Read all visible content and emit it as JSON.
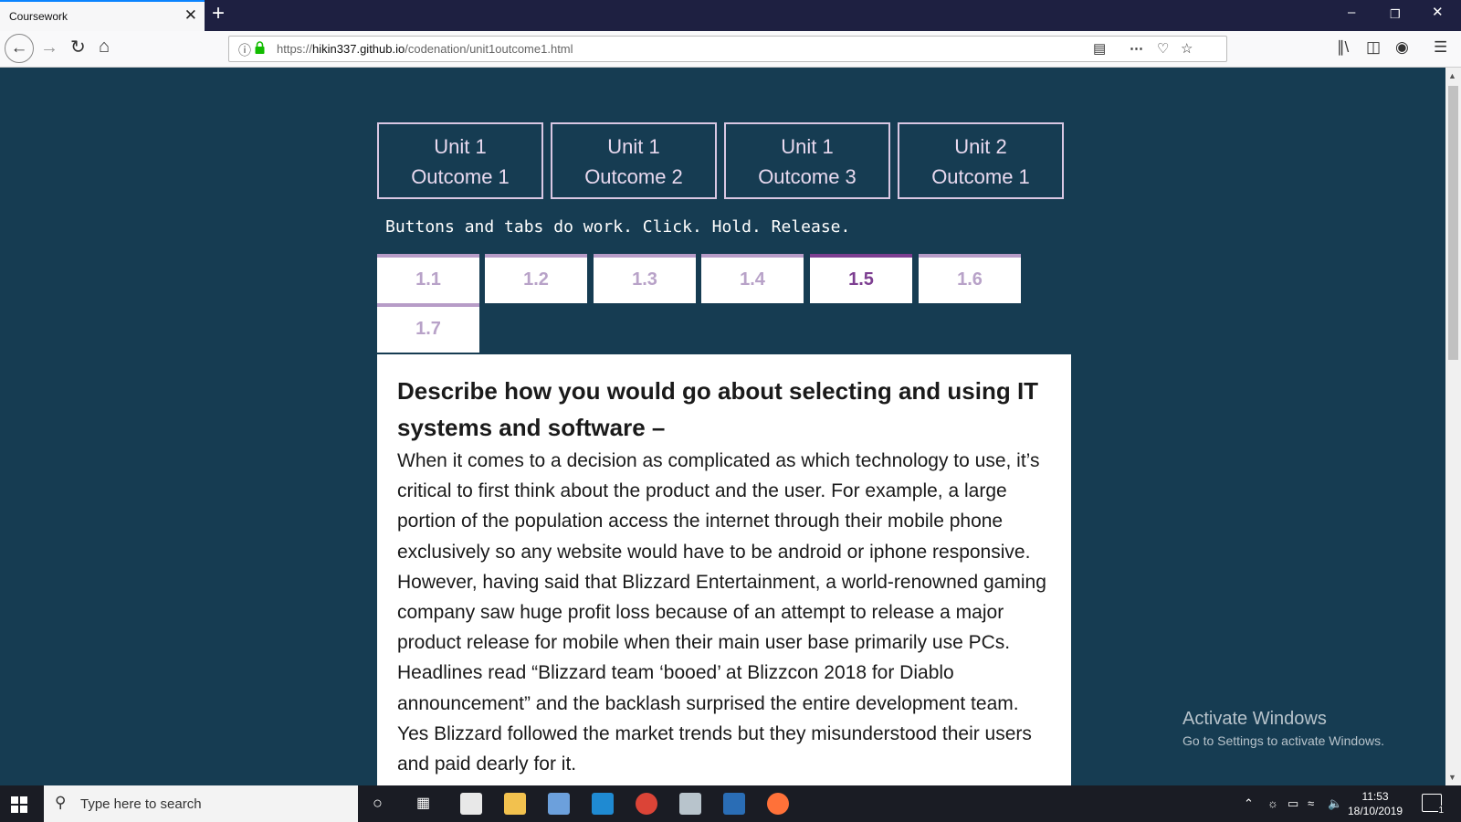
{
  "browser": {
    "tab_title": "Coursework",
    "tab_close": "✕",
    "new_tab": "+",
    "url_prefix": "https://",
    "url_domain": "hikin337.github.io",
    "url_path": "/codenation/unit1outcome1.html"
  },
  "page": {
    "units": [
      {
        "line1": "Unit 1",
        "line2": "Outcome 1"
      },
      {
        "line1": "Unit 1",
        "line2": "Outcome 2"
      },
      {
        "line1": "Unit 1",
        "line2": "Outcome 3"
      },
      {
        "line1": "Unit 2",
        "line2": "Outcome 1"
      }
    ],
    "hint": "Buttons and tabs do work. Click. Hold. Release.",
    "subtabs": [
      "1.1",
      "1.2",
      "1.3",
      "1.4",
      "1.5",
      "1.6",
      "1.7"
    ],
    "active_subtab": "1.5",
    "heading": "Describe how you would go about selecting and using IT systems and software –",
    "body": "When it comes to a decision as complicated as which technology to use, it’s critical to first think about the product and the user. For example, a large portion of the population access the internet through their mobile phone exclusively so any website would have to be android or iphone responsive. However, having said that Blizzard Entertainment, a world-renowned gaming company saw huge profit loss because of an attempt to release a major product release for mobile when their main user base primarily use PCs. Headlines read “Blizzard team ‘booed’ at Blizzcon 2018 for Diablo announcement” and the backlash surprised the entire development team. Yes Blizzard followed the market trends but they misunderstood their users and paid dearly for it."
  },
  "watermark": {
    "title": "Activate Windows",
    "subtitle": "Go to Settings to activate Windows."
  },
  "taskbar": {
    "search_placeholder": "Type here to search",
    "time": "11:53",
    "date": "18/10/2019",
    "notification_count": "1"
  },
  "colors": {
    "page_background": "#163c52",
    "accent_purple": "#7d3f91",
    "tab_inactive_text": "#b8a2c8"
  }
}
